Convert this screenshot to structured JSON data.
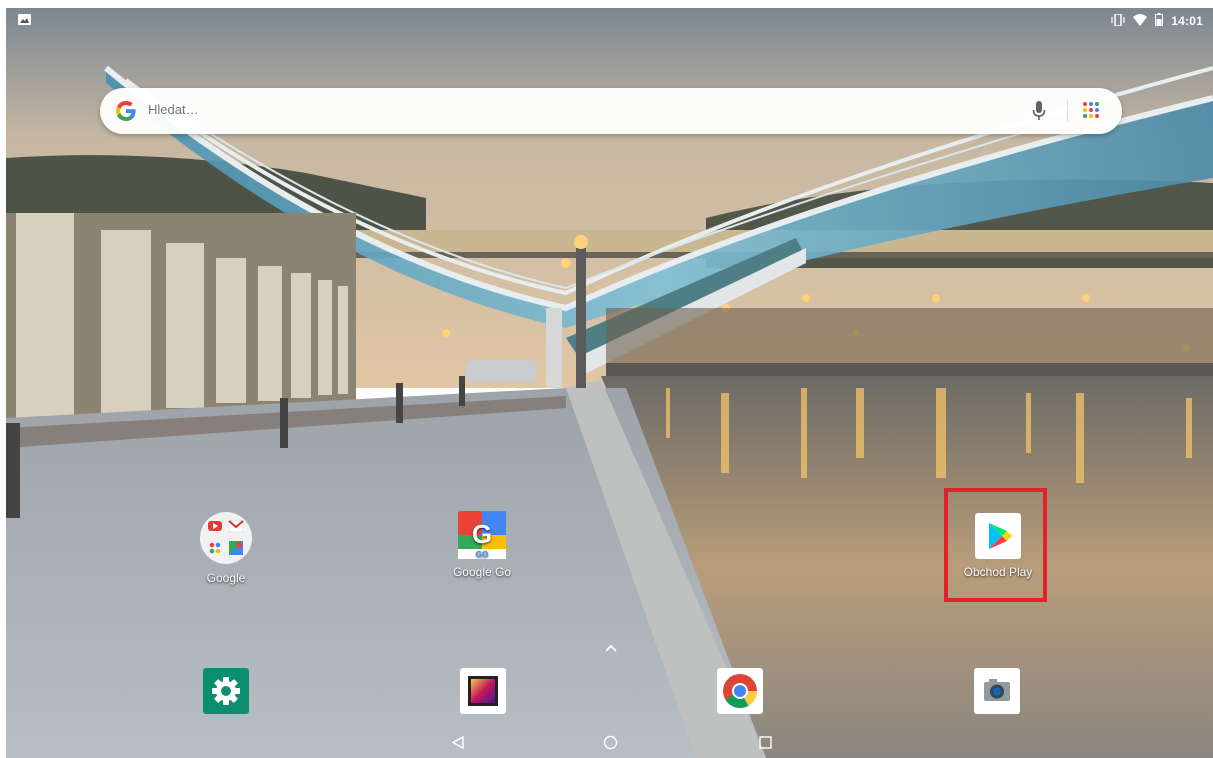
{
  "status_bar": {
    "time": "14:01",
    "left_icon": "image-notification-icon",
    "right_icons": [
      "vibrate-icon",
      "wifi-icon",
      "battery-icon"
    ]
  },
  "search": {
    "placeholder": "Hledat…",
    "icons": [
      "google-g-icon",
      "microphone-icon",
      "apps-grid-icon"
    ]
  },
  "home_apps": [
    {
      "label": "Google",
      "icon": "google-folder-icon"
    },
    {
      "label": "Google Go",
      "icon": "google-go-icon"
    },
    {
      "label": "Obchod Play",
      "icon": "play-store-icon",
      "highlighted": true
    }
  ],
  "dock_apps": [
    {
      "icon": "settings-icon"
    },
    {
      "icon": "gallery-icon"
    },
    {
      "icon": "chrome-icon"
    },
    {
      "icon": "camera-icon"
    }
  ],
  "nav": {
    "buttons": [
      "back-icon",
      "home-icon",
      "recents-icon"
    ]
  },
  "colors": {
    "highlight_border": "#e6202a",
    "settings_green": "#0c8f70"
  }
}
